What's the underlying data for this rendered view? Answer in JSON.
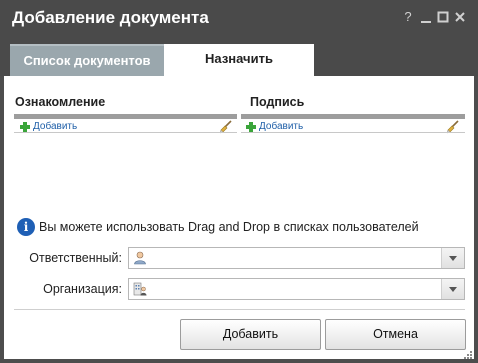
{
  "window": {
    "title": "Добавление документа",
    "help_glyph": "?"
  },
  "tabs": [
    {
      "label": "Список документов",
      "active": false
    },
    {
      "label": "Назначить",
      "active": true
    }
  ],
  "sections": {
    "familiarize": {
      "title": "Ознакомление",
      "add_label": "Добавить"
    },
    "signature": {
      "title": "Подпись",
      "add_label": "Добавить"
    }
  },
  "info": {
    "icon_text": "i",
    "text": "Вы можете использовать Drag and Drop в списках пользователей"
  },
  "fields": {
    "responsible": {
      "label": "Ответственный:",
      "value": ""
    },
    "organization": {
      "label": "Организация:",
      "value": ""
    }
  },
  "buttons": {
    "add": "Добавить",
    "cancel": "Отмена"
  },
  "colors": {
    "titlebar": "#4a4a4a",
    "inactive_tab": "#9aa7ad",
    "link": "#1f5fa8",
    "add_icon": "#3aa53a",
    "info_icon": "#1e5fb5"
  }
}
